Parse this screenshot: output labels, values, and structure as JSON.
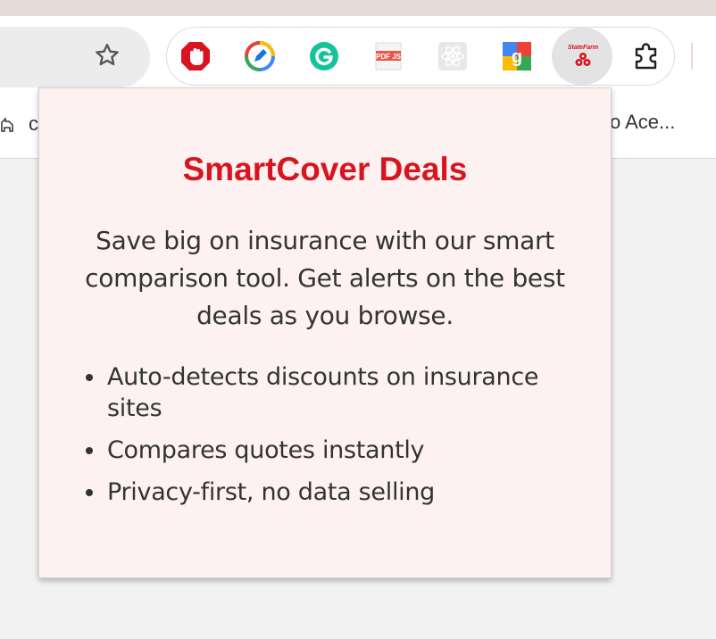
{
  "browser": {
    "bookmarks_bar": {
      "left_item_text": "c",
      "right_item_text": "o Ace..."
    },
    "toolbar": {
      "icons": [
        "bookmark-star-icon",
        "adblock-icon",
        "pen-edit-icon",
        "grammarly-icon",
        "pdfjs-icon",
        "react-devtools-icon",
        "google-photo-icon",
        "state-farm-icon",
        "extensions-puzzle-icon"
      ],
      "pdf_icon_label": "PDF JS",
      "statefarm_icon_label": "StateFarm"
    }
  },
  "popup": {
    "title": "SmartCover Deals",
    "description": "Save big on insurance with our smart comparison tool. Get alerts on the best deals as you browse.",
    "features": [
      "Auto-detects discounts on insurance sites",
      "Compares quotes instantly",
      "Privacy-first, no data selling"
    ]
  },
  "colors": {
    "accent_red": "#d8141e",
    "popup_bg": "#fdf2f1"
  }
}
